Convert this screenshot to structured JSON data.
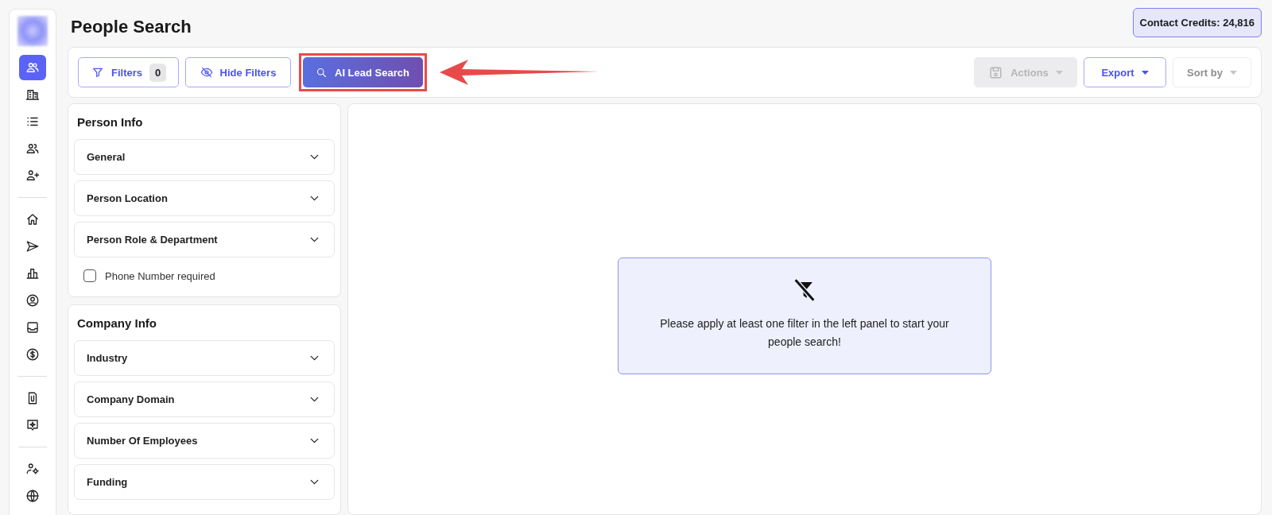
{
  "sidebar": {
    "groups": [
      {
        "items": [
          {
            "selected": true
          },
          {
            "selected": false
          },
          {
            "selected": false
          },
          {
            "selected": false
          },
          {
            "selected": false
          }
        ]
      },
      {
        "items": [
          {
            "selected": false
          },
          {
            "selected": false
          },
          {
            "selected": false
          },
          {
            "selected": false
          },
          {
            "selected": false
          },
          {
            "selected": false
          }
        ]
      },
      {
        "items": [
          {
            "selected": false
          },
          {
            "selected": false
          }
        ]
      },
      {
        "items": [
          {
            "selected": false
          },
          {
            "selected": false
          }
        ]
      }
    ]
  },
  "header": {
    "title": "People Search",
    "credits": "Contact Credits: 24,816"
  },
  "toolbar": {
    "left": [
      {
        "kind": "filters",
        "label": "Filters",
        "count": "0"
      },
      {
        "kind": "hide",
        "label": "Hide Filters"
      },
      {
        "kind": "ai",
        "label": "AI Lead Search",
        "highlighted": true
      }
    ],
    "right": [
      {
        "kind": "actions",
        "label": "Actions",
        "disabled": true
      },
      {
        "kind": "export",
        "label": "Export",
        "disabled": false
      },
      {
        "kind": "sort",
        "label": "Sort by"
      }
    ]
  },
  "filter_sections": [
    {
      "title": "Person Info",
      "items": [
        {
          "kind": "accordion",
          "label": "General",
          "expanded": false
        },
        {
          "kind": "accordion",
          "label": "Person Location",
          "expanded": false
        },
        {
          "kind": "accordion",
          "label": "Person Role & Department",
          "expanded": false
        },
        {
          "kind": "checkbox",
          "label": "Phone Number required",
          "checked": false
        }
      ]
    },
    {
      "title": "Company Info",
      "items": [
        {
          "kind": "accordion",
          "label": "Industry",
          "expanded": false
        },
        {
          "kind": "accordion",
          "label": "Company Domain",
          "expanded": false
        },
        {
          "kind": "accordion",
          "label": "Number Of Employees",
          "expanded": false
        },
        {
          "kind": "accordion",
          "label": "Funding",
          "expanded": false
        }
      ]
    }
  ],
  "empty_state": {
    "message": "Please apply at least one filter in the left panel to start your people search!"
  }
}
